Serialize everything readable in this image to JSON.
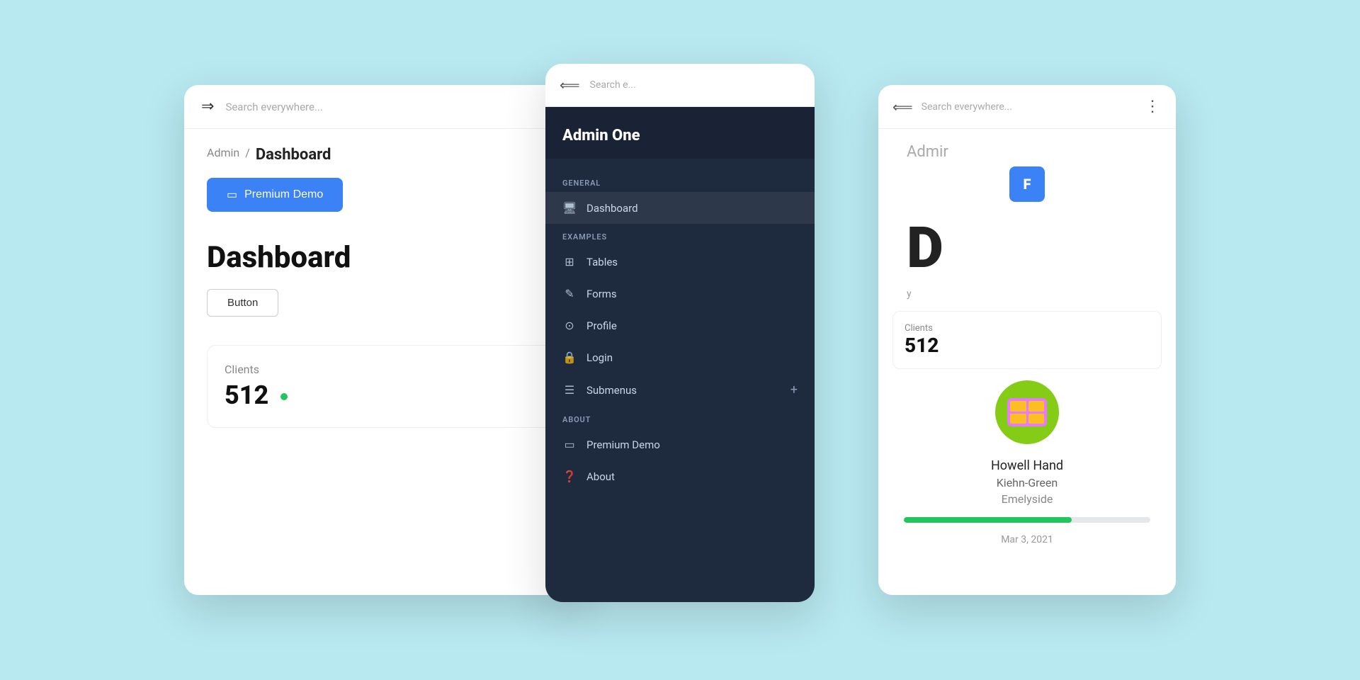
{
  "background_color": "#b8e8f0",
  "left_card": {
    "hamburger_icon": "⇒",
    "search_placeholder": "Search everywhere...",
    "breadcrumb_admin": "Admin",
    "breadcrumb_separator": "/",
    "breadcrumb_current": "Dashboard",
    "premium_btn_label": "Premium Demo",
    "dashboard_title": "Dashboard",
    "button_label": "Button",
    "stats_label": "Clients",
    "stats_value": "512"
  },
  "center_card": {
    "back_icon": "⟸",
    "search_placeholder": "Search e...",
    "title_prefix": "Admin",
    "title_bold": "One",
    "sections": [
      {
        "section_label": "GENERAL",
        "items": [
          {
            "icon": "🖥",
            "label": "Dashboard"
          }
        ]
      },
      {
        "section_label": "EXAMPLES",
        "items": [
          {
            "icon": "⊞",
            "label": "Tables"
          },
          {
            "icon": "✎",
            "label": "Forms"
          },
          {
            "icon": "⊙",
            "label": "Profile"
          },
          {
            "icon": "🔒",
            "label": "Login"
          },
          {
            "icon": "☰",
            "label": "Submenus",
            "has_plus": true
          }
        ]
      },
      {
        "section_label": "ABOUT",
        "items": [
          {
            "icon": "▭",
            "label": "Premium Demo"
          },
          {
            "icon": "?",
            "label": "About"
          }
        ]
      }
    ]
  },
  "right_card": {
    "back_icon": "⟸",
    "search_placeholder": "Search everywhere...",
    "more_icon": "⋮",
    "partial_admin_text": "Admin",
    "person_name": "Howell Hand",
    "company_name": "Kiehn-Green",
    "city_name": "Emelyside",
    "progress_percent": 68,
    "date_text": "Mar 3, 2021",
    "stats_label": "Clients",
    "stats_value": "512"
  },
  "icons": {
    "monitor": "▣",
    "table": "⊞",
    "edit": "✎",
    "user": "⊙",
    "lock": "🔒",
    "menu": "☰",
    "card": "▭",
    "help": "❓",
    "plus": "+",
    "hamburger": "⇒",
    "back": "⟵"
  }
}
